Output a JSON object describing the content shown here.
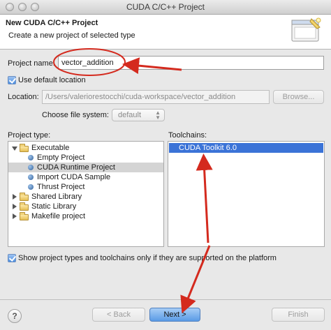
{
  "window": {
    "title": "CUDA C/C++ Project"
  },
  "header": {
    "title": "New CUDA C/C++ Project",
    "subtitle": "Create a new project of selected type"
  },
  "project_name": {
    "label": "Project name:",
    "value": "vector_addition"
  },
  "default_location": {
    "label": "Use default location",
    "checked": true
  },
  "location": {
    "label": "Location:",
    "value": "/Users/valeriorestocchi/cuda-workspace/vector_addition",
    "browse_label": "Browse..."
  },
  "file_system": {
    "label": "Choose file system:",
    "value": "default"
  },
  "project_type": {
    "label": "Project type:",
    "items": [
      {
        "label": "Executable",
        "kind": "folder",
        "expanded": true
      },
      {
        "label": "Empty Project",
        "kind": "leaf"
      },
      {
        "label": "CUDA Runtime Project",
        "kind": "leaf",
        "selected": true
      },
      {
        "label": "Import CUDA Sample",
        "kind": "leaf"
      },
      {
        "label": "Thrust Project",
        "kind": "leaf"
      },
      {
        "label": "Shared Library",
        "kind": "folder",
        "expanded": false
      },
      {
        "label": "Static Library",
        "kind": "folder",
        "expanded": false
      },
      {
        "label": "Makefile project",
        "kind": "folder",
        "expanded": false
      }
    ]
  },
  "toolchains": {
    "label": "Toolchains:",
    "items": [
      {
        "label": "CUDA Toolkit 6.0",
        "selected": true
      }
    ]
  },
  "supported_only": {
    "label": "Show project types and toolchains only if they are supported on the platform",
    "checked": true
  },
  "footer": {
    "help_glyph": "?",
    "back_label": "< Back",
    "next_label": "Next >",
    "finish_label": "Finish"
  },
  "colors": {
    "annotation": "#d42a1e",
    "selection": "#3b73d7",
    "primary_button": "#5a9be6"
  },
  "icons": {
    "help": "help-icon",
    "folder": "folder-icon",
    "bullet": "project-bullet-icon",
    "wizard": "wizard-banner-icon"
  }
}
